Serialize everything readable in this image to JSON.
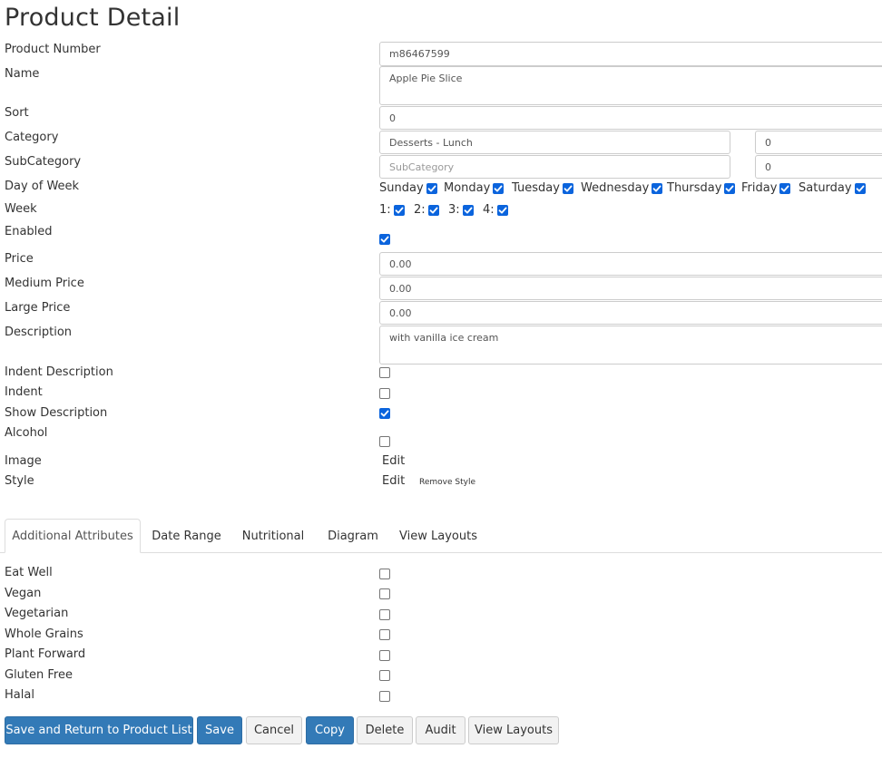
{
  "page": {
    "title": "Product Detail"
  },
  "labels": {
    "product_number": "Product Number",
    "name": "Name",
    "sort": "Sort",
    "category": "Category",
    "subcategory": "SubCategory",
    "day_of_week": "Day of Week",
    "week": "Week",
    "enabled": "Enabled",
    "price": "Price",
    "medium_price": "Medium Price",
    "large_price": "Large Price",
    "description": "Description",
    "indent_description": "Indent Description",
    "indent": "Indent",
    "show_description": "Show Description",
    "alcohol": "Alcohol",
    "image": "Image",
    "style": "Style"
  },
  "fields": {
    "product_number": "m86467599",
    "name": "Apple Pie Slice",
    "sort": "0",
    "category": "Desserts - Lunch",
    "category_sort": "0",
    "subcategory_placeholder": "SubCategory",
    "subcategory_sort": "0",
    "price": "0.00",
    "medium_price": "0.00",
    "large_price": "0.00",
    "description": "with vanilla ice cream"
  },
  "days": [
    {
      "label": "Sunday",
      "checked": true
    },
    {
      "label": "Monday",
      "checked": true
    },
    {
      "label": "Tuesday",
      "checked": true
    },
    {
      "label": "Wednesday",
      "checked": true
    },
    {
      "label": "Thursday",
      "checked": true
    },
    {
      "label": "Friday",
      "checked": true
    },
    {
      "label": "Saturday",
      "checked": true
    }
  ],
  "weeks": [
    {
      "label": "1:",
      "checked": true
    },
    {
      "label": "2:",
      "checked": true
    },
    {
      "label": "3:",
      "checked": true
    },
    {
      "label": "4:",
      "checked": true
    }
  ],
  "flags": {
    "enabled": true,
    "indent_description": false,
    "indent": false,
    "show_description": true,
    "alcohol": false
  },
  "links": {
    "image_edit": "Edit",
    "style_edit": "Edit",
    "remove_style": "Remove Style"
  },
  "tabs": [
    {
      "label": "Additional Attributes",
      "active": true
    },
    {
      "label": "Date Range",
      "active": false
    },
    {
      "label": "Nutritional",
      "active": false
    },
    {
      "label": "Diagram",
      "active": false
    },
    {
      "label": "View Layouts",
      "active": false
    }
  ],
  "attributes": [
    {
      "label": "Eat Well",
      "checked": false
    },
    {
      "label": "Vegan",
      "checked": false
    },
    {
      "label": "Vegetarian",
      "checked": false
    },
    {
      "label": "Whole Grains",
      "checked": false
    },
    {
      "label": "Plant Forward",
      "checked": false
    },
    {
      "label": "Gluten Free",
      "checked": false
    },
    {
      "label": "Halal",
      "checked": false
    }
  ],
  "buttons": {
    "save_return": "Save and Return to Product List",
    "save": "Save",
    "cancel": "Cancel",
    "copy": "Copy",
    "delete": "Delete",
    "audit": "Audit",
    "view_layouts": "View Layouts"
  },
  "colors": {
    "primary": "#337ab7",
    "checkbox_checked": "#0b64dd",
    "border": "#cccccc"
  }
}
